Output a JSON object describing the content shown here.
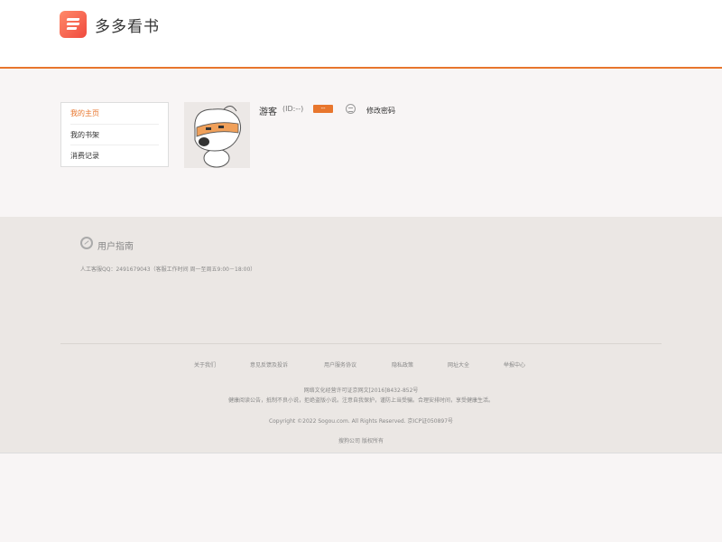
{
  "app": {
    "title": "多多看书"
  },
  "sidebar": {
    "items": [
      {
        "label": "我的主页",
        "active": true
      },
      {
        "label": "我的书架"
      },
      {
        "label": "消费记录"
      }
    ]
  },
  "profile": {
    "username": "游客",
    "id_text": "(ID:--)",
    "badge": "--",
    "change_password": "修改密码"
  },
  "guide": {
    "title": "用户指南",
    "service": "人工客服QQ：2491679043（客服工作时间 周一至周五9:00－18:00）"
  },
  "footer": {
    "links": [
      "关于我们",
      "意见反馈及投诉",
      "用户服务协议",
      "隐私政策",
      "网址大全",
      "举报中心"
    ],
    "license": "网络文化经营许可证京网文[2016]8432-852号",
    "health_notice": "健康阅读公告，抵制不良小说，拒绝盗版小说。注意自我保护，谨防上当受骗。合理安排时间，享受健康生活。",
    "copyright": "Copyright ©2022 Sogou.com. All Rights Reserved. 京ICP证050897号",
    "company": "搜狗公司 版权所有"
  },
  "colors": {
    "accent": "#e8762d",
    "logo": "#f04a3e",
    "footer_bg": "#ebe7e4"
  },
  "icons": {
    "logo": "book-logo-icon",
    "settings": "settings-icon",
    "guide": "compass-icon",
    "avatar": "mascot-avatar"
  }
}
